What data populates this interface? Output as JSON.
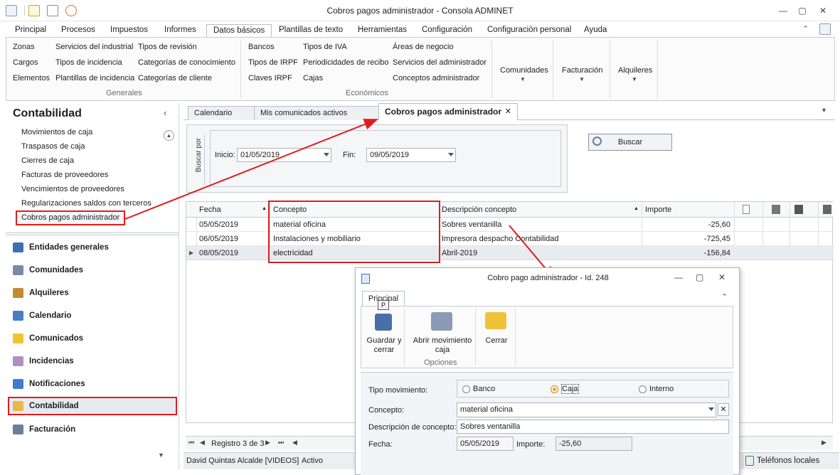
{
  "window": {
    "title": "Cobros pagos administrador - Consola ADMINET",
    "min": "—",
    "max": "▢",
    "close": "✕"
  },
  "ribbon_tabs": [
    "Principal",
    "Procesos",
    "Impuestos",
    "Informes",
    "Datos básicos",
    "Plantillas de texto",
    "Herramientas",
    "Configuración",
    "Configuración personal",
    "Ayuda"
  ],
  "ribbon": {
    "generales": {
      "label": "Generales",
      "col1": [
        "Zonas",
        "Cargos",
        "Elementos"
      ],
      "col2": [
        "Servicios del industrial",
        "Tipos de incidencia",
        "Plantillas de incidencia"
      ],
      "col3": [
        "Tipos de revisión",
        "Categorías de conocimiento",
        "Categorías de cliente"
      ]
    },
    "economicos": {
      "label": "Económicos",
      "col1": [
        "Bancos",
        "Tipos de IRPF",
        "Claves IRPF"
      ],
      "col2": [
        "Tipos de IVA",
        "Periodicidades de recibo",
        "Cajas"
      ],
      "col3": [
        "Áreas de negocio",
        "Servicios del administrador",
        "Conceptos administrador"
      ]
    },
    "big": [
      "Comunidades",
      "Facturación",
      "Alquileres"
    ]
  },
  "nav": {
    "title": "Contabilidad",
    "items": [
      "Movimientos de caja",
      "Traspasos de caja",
      "Cierres de caja",
      "Facturas de proveedores",
      "Vencimientos de proveedores",
      "Regularizaciones saldos con terceros",
      "Cobros pagos administrador"
    ],
    "sections": [
      "Entidades generales",
      "Comunidades",
      "Alquileres",
      "Calendario",
      "Comunicados",
      "Incidencias",
      "Notificaciones",
      "Contabilidad",
      "Facturación"
    ]
  },
  "doc_tabs": [
    "Calendario",
    "Mis comunicados activos",
    "Cobros pagos administrador"
  ],
  "search": {
    "side_label": "Buscar por",
    "start_label": "Inicio:",
    "start_value": "01/05/2019",
    "end_label": "Fin:",
    "end_value": "09/05/2019",
    "button": "Buscar"
  },
  "grid": {
    "headers": [
      "Fecha",
      "Concepto",
      "Descripción concepto",
      "Importe"
    ],
    "rows": [
      {
        "fecha": "05/05/2019",
        "concepto": "material oficina",
        "descripcion": "Sobres ventanilla",
        "importe": "-25,60"
      },
      {
        "fecha": "06/05/2019",
        "concepto": "Instalaciones y mobiliario",
        "descripcion": "Impresora despacho Contabilidad",
        "importe": "-725,45"
      },
      {
        "fecha": "08/05/2019",
        "concepto": "electricidad",
        "descripcion": "Abril-2019",
        "importe": "-156,84"
      }
    ],
    "record": "Registro 3 de 3"
  },
  "status": {
    "user": "David Quintas Alcalde [VIDEOS]",
    "state": "Activo",
    "phones": "Teléfonos locales"
  },
  "dialog": {
    "title": "Cobro pago administrador - Id. 248",
    "tab": "Principal",
    "keytip": "P",
    "buttons": [
      "Guardar y cerrar",
      "Abrir movimiento caja",
      "Cerrar"
    ],
    "group": "Opciones",
    "tipo_label": "Tipo movimiento:",
    "tipos": [
      "Banco",
      "Caja",
      "Interno"
    ],
    "concepto_label": "Concepto:",
    "concepto_value": "material oficina",
    "descripcion_label": "Descripción de concepto:",
    "descripcion_value": "Sobres ventanilla",
    "fecha_label": "Fecha:",
    "fecha_value": "05/05/2019",
    "importe_label": "Importe:",
    "importe_value": "-25,60"
  },
  "colors": {
    "highlight_red": "#dd1e1e",
    "selection": "#c9d7ea",
    "accent_orange": "#f0a51a"
  }
}
